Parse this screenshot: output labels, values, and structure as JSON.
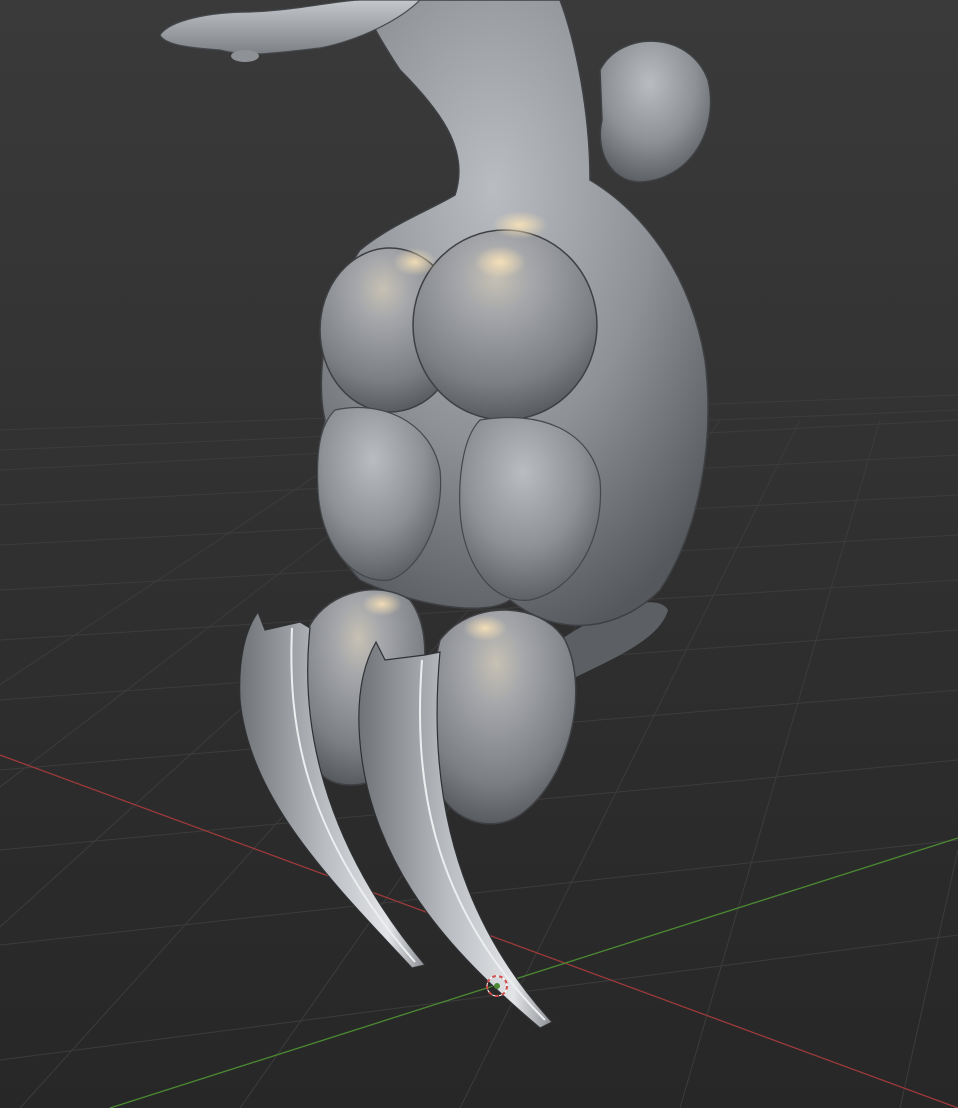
{
  "viewport": {
    "kind": "3d-viewport",
    "shading": "solid",
    "object": "sculpt-mesh",
    "overlays": [
      "floor-grid",
      "x-axis-line",
      "y-axis-line",
      "3d-cursor"
    ]
  },
  "colors": {
    "background_top": "#3a3a3a",
    "background_bottom": "#272727",
    "grid": "#3c3c3c",
    "x_axis": "#9c3a3a",
    "y_axis": "#4b8a32",
    "mesh_light": "#c9ccd1",
    "mesh_mid": "#8d9095",
    "mesh_dark": "#4c4f53",
    "cursor_ring": "#d24a4a"
  }
}
